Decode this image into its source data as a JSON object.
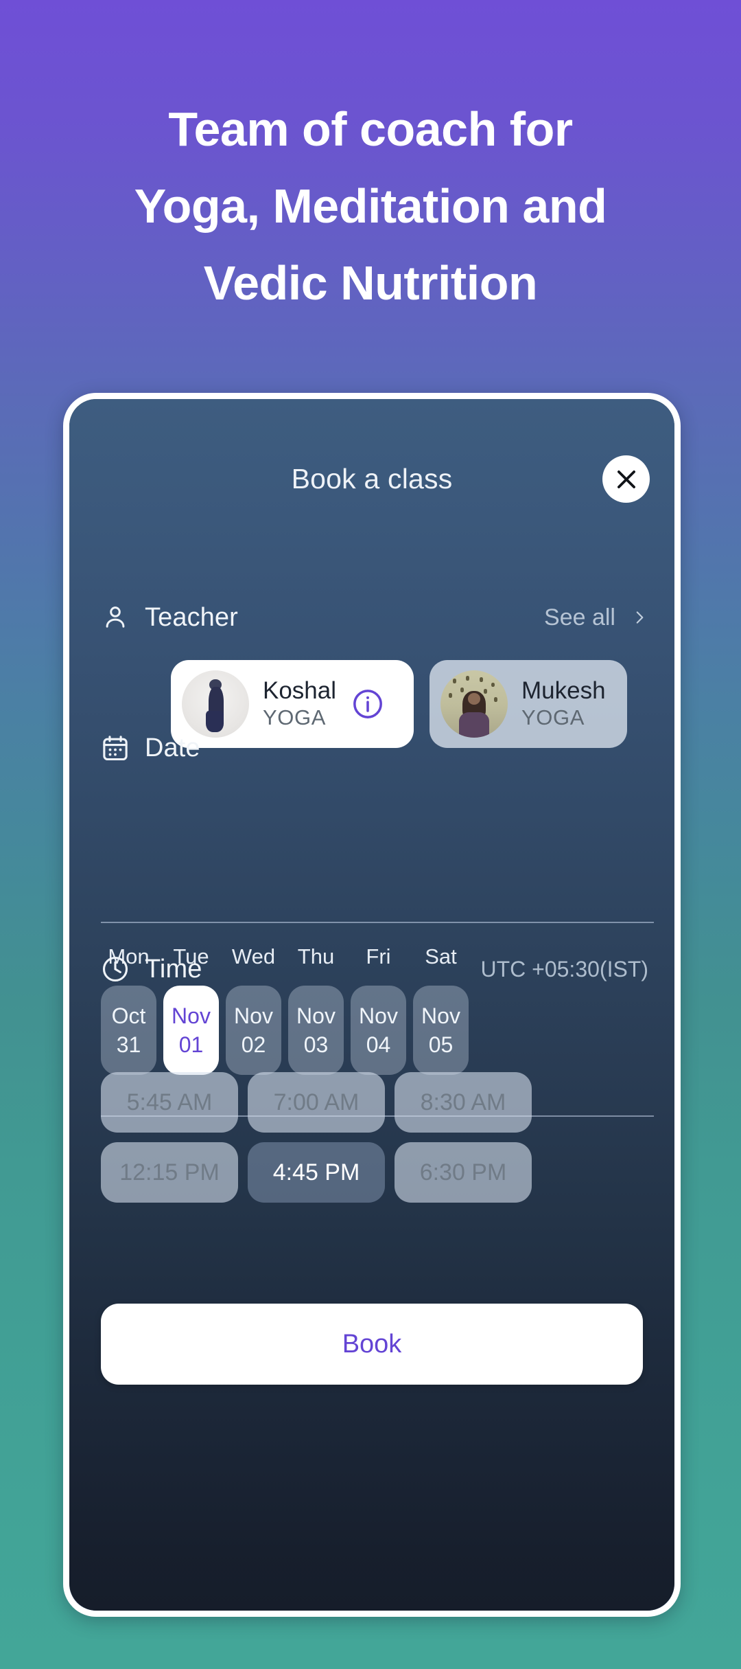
{
  "hero": {
    "line1": "Team of coach for",
    "line2": "Yoga, Meditation and",
    "line3": "Vedic Nutrition"
  },
  "colors": {
    "bg_top": "#6f4fd6",
    "bg_bottom": "#43a698",
    "accent_purple": "#6344d4",
    "screen_top": "#3e5d80",
    "screen_bottom": "#161d2a"
  },
  "sheet": {
    "title": "Book a class",
    "close_icon": "close-icon"
  },
  "teacher_section": {
    "icon": "person-icon",
    "label": "Teacher",
    "see_all_label": "See all",
    "chevron_icon": "chevron-right-icon",
    "cards": [
      {
        "name": "Koshal",
        "discipline": "YOGA",
        "selected": true,
        "info_icon": "info-icon"
      },
      {
        "name": "Mukesh",
        "discipline": "YOGA",
        "selected": false,
        "info_icon": null
      }
    ]
  },
  "date_section": {
    "icon": "calendar-icon",
    "label": "Date",
    "weekdays": [
      "Mon",
      "Tue",
      "Wed",
      "Thu",
      "Fri",
      "Sat"
    ],
    "days": [
      {
        "month": "Oct",
        "day": "31",
        "selected": false
      },
      {
        "month": "Nov",
        "day": "01",
        "selected": true
      },
      {
        "month": "Nov",
        "day": "02",
        "selected": false
      },
      {
        "month": "Nov",
        "day": "03",
        "selected": false
      },
      {
        "month": "Nov",
        "day": "04",
        "selected": false
      },
      {
        "month": "Nov",
        "day": "05",
        "selected": false
      }
    ]
  },
  "time_section": {
    "icon": "clock-icon",
    "label": "Time",
    "timezone": "UTC +05:30(IST)",
    "slots": [
      {
        "label": "5:45 AM",
        "available": false
      },
      {
        "label": "7:00 AM",
        "available": false
      },
      {
        "label": "8:30 AM",
        "available": false
      },
      {
        "label": "12:15 PM",
        "available": false
      },
      {
        "label": "4:45 PM",
        "available": true
      },
      {
        "label": "6:30 PM",
        "available": false
      }
    ]
  },
  "footer": {
    "book_label": "Book"
  }
}
